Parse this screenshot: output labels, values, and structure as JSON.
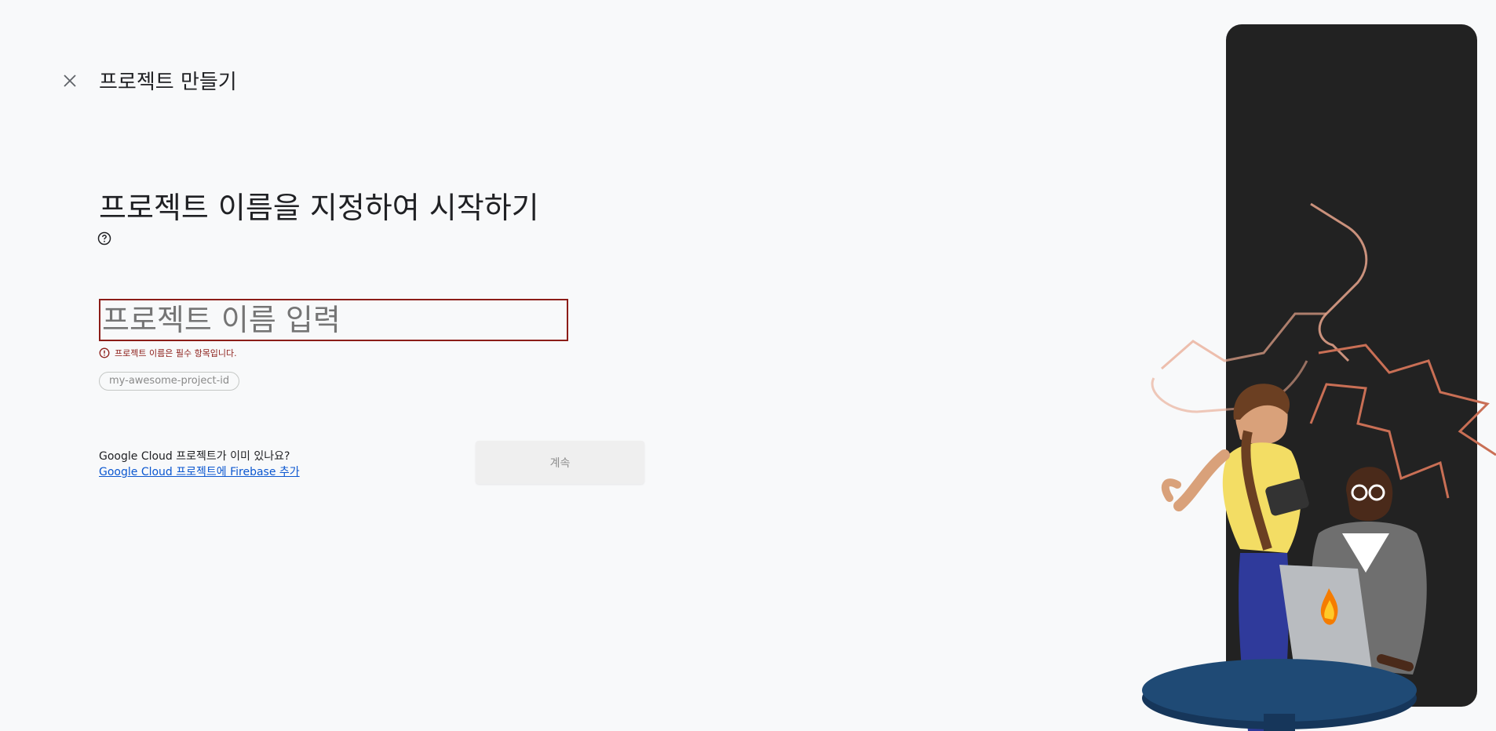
{
  "header": {
    "close_icon": "close-icon",
    "title": "프로젝트 만들기"
  },
  "main": {
    "heading": "프로젝트 이름을 지정하여 시작하기",
    "help_icon": "help-circle-icon",
    "name_input": {
      "value": "",
      "placeholder": "프로젝트 이름 입력"
    },
    "error": {
      "icon": "error-circle-icon",
      "message": "프로젝트 이름은 필수 항목입니다."
    },
    "project_id_chip": "my-awesome-project-id",
    "existing_project": {
      "question": "Google Cloud 프로젝트가 이미 있나요?",
      "link": "Google Cloud 프로젝트에 Firebase 추가"
    },
    "continue_label": "계속"
  },
  "colors": {
    "error": "#8c1d18",
    "link": "#0b57d0",
    "panel": "#222222",
    "accent_outline": "#e8a58c"
  },
  "illustration": {
    "description_icon": "firebase-flame-icon"
  }
}
